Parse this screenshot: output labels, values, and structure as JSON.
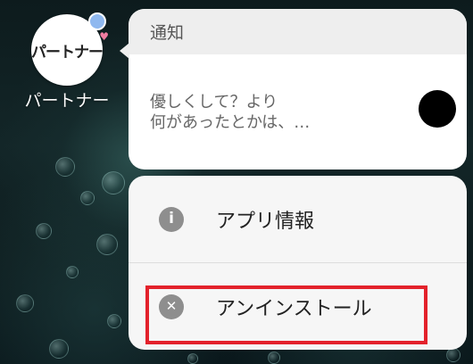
{
  "app": {
    "name": "パートナー",
    "icon_logo": "パートナー",
    "icon_name": "partner-app-icon",
    "badge_color": "#8fb8ef"
  },
  "notification": {
    "header": "通知",
    "message_line1": "優しくして？より",
    "message_line2": "何があったとかは、…"
  },
  "menu": {
    "items": [
      {
        "label": "アプリ情報",
        "icon": "info-icon",
        "icon_glyph": "i"
      },
      {
        "label": "アンインストール",
        "icon": "close-circle-icon",
        "icon_glyph": "✕"
      }
    ]
  },
  "highlight": {
    "color": "#e3212b",
    "target": "アンインストール"
  }
}
